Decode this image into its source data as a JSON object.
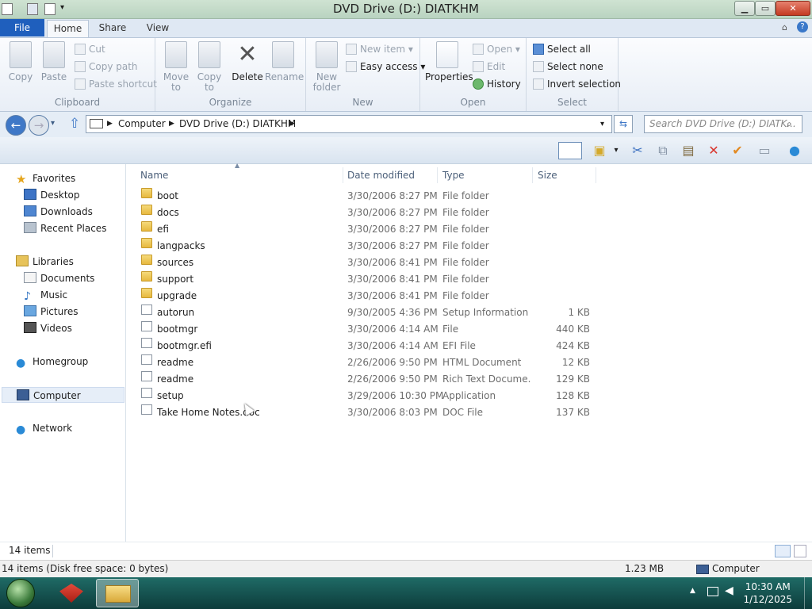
{
  "window": {
    "title": "DVD Drive (D:) DIATKHM",
    "min": "▁",
    "max": "▭",
    "close": "✕"
  },
  "tabs": {
    "file": "File",
    "home": "Home",
    "share": "Share",
    "view": "View"
  },
  "ribbon": {
    "clipboard": {
      "label": "Clipboard",
      "copy": "Copy",
      "paste": "Paste",
      "cut": "Cut",
      "copy_path": "Copy path",
      "paste_shortcut": "Paste shortcut"
    },
    "organize": {
      "label": "Organize",
      "move_to": "Move to",
      "copy_to": "Copy to",
      "delete": "Delete",
      "rename": "Rename"
    },
    "new": {
      "label": "New",
      "new_folder": "New folder",
      "new_item": "New item",
      "easy_access": "Easy access"
    },
    "open": {
      "label": "Open",
      "properties": "Properties",
      "open": "Open",
      "edit": "Edit",
      "history": "History"
    },
    "select": {
      "label": "Select",
      "select_all": "Select all",
      "select_none": "Select none",
      "invert_selection": "Invert selection"
    }
  },
  "address": {
    "seg1": "Computer",
    "seg2": "DVD Drive (D:) DIATKHM",
    "search_placeholder": "Search DVD Drive (D:) DIATK..."
  },
  "nav": {
    "favorites": "Favorites",
    "desktop": "Desktop",
    "downloads": "Downloads",
    "recent_places": "Recent Places",
    "libraries": "Libraries",
    "documents": "Documents",
    "music": "Music",
    "pictures": "Pictures",
    "videos": "Videos",
    "homegroup": "Homegroup",
    "computer": "Computer",
    "network": "Network"
  },
  "columns": {
    "name": "Name",
    "date": "Date modified",
    "type": "Type",
    "size": "Size"
  },
  "files": [
    {
      "name": "boot",
      "date": "3/30/2006 8:27 PM",
      "type": "File folder",
      "size": "",
      "kind": "folder"
    },
    {
      "name": "docs",
      "date": "3/30/2006 8:27 PM",
      "type": "File folder",
      "size": "",
      "kind": "folder"
    },
    {
      "name": "efi",
      "date": "3/30/2006 8:27 PM",
      "type": "File folder",
      "size": "",
      "kind": "folder"
    },
    {
      "name": "langpacks",
      "date": "3/30/2006 8:27 PM",
      "type": "File folder",
      "size": "",
      "kind": "folder"
    },
    {
      "name": "sources",
      "date": "3/30/2006 8:41 PM",
      "type": "File folder",
      "size": "",
      "kind": "folder"
    },
    {
      "name": "support",
      "date": "3/30/2006 8:41 PM",
      "type": "File folder",
      "size": "",
      "kind": "folder"
    },
    {
      "name": "upgrade",
      "date": "3/30/2006 8:41 PM",
      "type": "File folder",
      "size": "",
      "kind": "folder"
    },
    {
      "name": "autorun",
      "date": "9/30/2005 4:36 PM",
      "type": "Setup Information",
      "size": "1 KB",
      "kind": "file"
    },
    {
      "name": "bootmgr",
      "date": "3/30/2006 4:14 AM",
      "type": "File",
      "size": "440 KB",
      "kind": "file"
    },
    {
      "name": "bootmgr.efi",
      "date": "3/30/2006 4:14 AM",
      "type": "EFI File",
      "size": "424 KB",
      "kind": "file"
    },
    {
      "name": "readme",
      "date": "2/26/2006 9:50 PM",
      "type": "HTML Document",
      "size": "12 KB",
      "kind": "file"
    },
    {
      "name": "readme",
      "date": "2/26/2006 9:50 PM",
      "type": "Rich Text Docume...",
      "size": "129 KB",
      "kind": "file"
    },
    {
      "name": "setup",
      "date": "3/29/2006 10:30 PM",
      "type": "Application",
      "size": "128 KB",
      "kind": "file"
    },
    {
      "name": "Take Home Notes.doc",
      "date": "3/30/2006 8:03 PM",
      "type": "DOC File",
      "size": "137 KB",
      "kind": "file"
    }
  ],
  "status": {
    "items": "14 items",
    "disk": "14 items (Disk free space: 0 bytes)",
    "size": "1.23 MB",
    "location": "Computer"
  },
  "taskbar": {
    "time": "10:30 AM",
    "date": "1/12/2025"
  },
  "colors": {
    "accent": "#1f5fbd",
    "taskbar": "#1f6b66"
  }
}
